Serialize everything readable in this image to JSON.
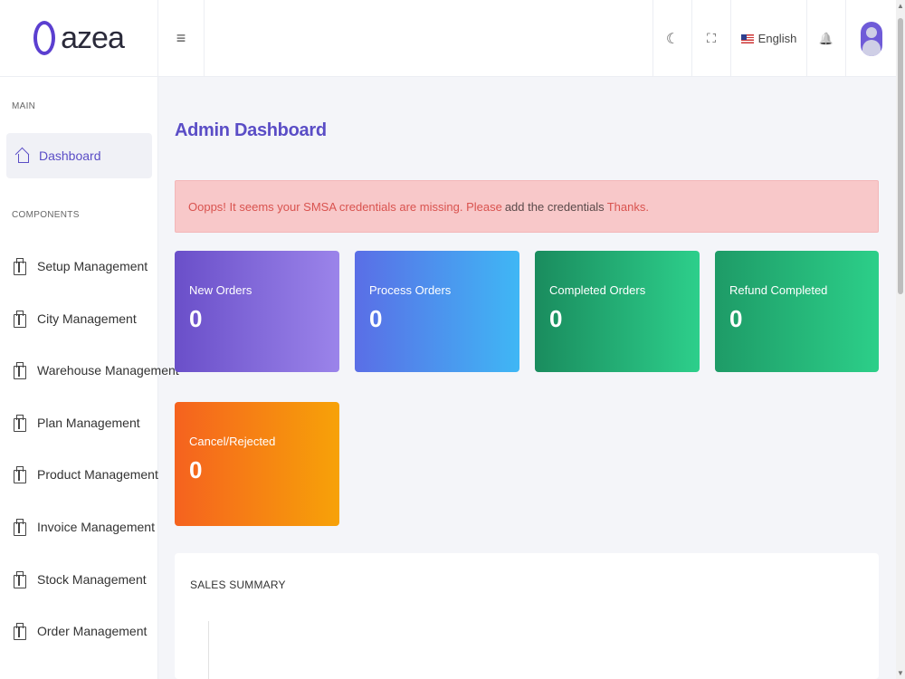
{
  "brand": {
    "name": "azea"
  },
  "sidebar": {
    "section_main": "MAIN",
    "section_components": "COMPONENTS",
    "active_item": {
      "label": "Dashboard",
      "icon": "home-icon"
    },
    "items": [
      {
        "label": "Setup Management",
        "icon": "building-icon"
      },
      {
        "label": "City Management",
        "icon": "building-icon"
      },
      {
        "label": "Warehouse Management",
        "icon": "building-icon"
      },
      {
        "label": "Plan Management",
        "icon": "building-icon"
      },
      {
        "label": "Product Management",
        "icon": "building-icon"
      },
      {
        "label": "Invoice Management",
        "icon": "building-icon"
      },
      {
        "label": "Stock Management",
        "icon": "building-icon"
      },
      {
        "label": "Order Management",
        "icon": "building-icon"
      }
    ]
  },
  "header": {
    "menu_icon": "≡",
    "theme_icon": "☾",
    "fullscreen_icon": "⛶",
    "language": "English",
    "bell_icon": "🔔"
  },
  "main": {
    "title": "Admin Dashboard",
    "alert": {
      "part1": "Oopps! It seems your SMSA credentials are missing. Please",
      "part2": "add the credentials",
      "part3": "Thanks."
    },
    "cards": [
      {
        "label": "New Orders",
        "value": "0"
      },
      {
        "label": "Process Orders",
        "value": "0"
      },
      {
        "label": "Completed Orders",
        "value": "0"
      },
      {
        "label": "Refund Completed",
        "value": "0"
      },
      {
        "label": "Cancel/Rejected",
        "value": "0"
      }
    ],
    "sales_summary_title": "SALES SUMMARY"
  },
  "colors": {
    "accent": "#5a4dc6",
    "alert_bg": "#f8c8c9",
    "alert_text": "#d9534f"
  }
}
